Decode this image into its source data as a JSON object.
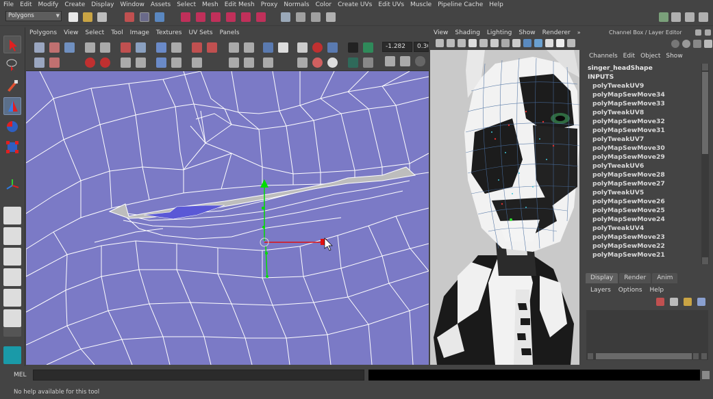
{
  "menubar": [
    "File",
    "Edit",
    "Modify",
    "Create",
    "Display",
    "Window",
    "Assets",
    "Select",
    "Mesh",
    "Edit Mesh",
    "Proxy",
    "Normals",
    "Color",
    "Create UVs",
    "Edit UVs",
    "Muscle",
    "Pipeline Cache",
    "Help"
  ],
  "mode_selector": "Polygons",
  "uv_editor": {
    "menu": [
      "Polygons",
      "View",
      "Select",
      "Tool",
      "Image",
      "Textures",
      "UV Sets",
      "Panels"
    ],
    "coord_u": "-1.282",
    "coord_v": "0.360"
  },
  "perspective": {
    "menu": [
      "View",
      "Shading",
      "Lighting",
      "Show",
      "Renderer"
    ]
  },
  "channel_box": {
    "title": "Channel Box / Layer Editor",
    "menu": [
      "Channels",
      "Edit",
      "Object",
      "Show"
    ],
    "object": "singer_headShape",
    "inputs_label": "INPUTS",
    "inputs": [
      "polyTweakUV9",
      "polyMapSewMove34",
      "polyMapSewMove33",
      "polyTweakUV8",
      "polyMapSewMove32",
      "polyMapSewMove31",
      "polyTweakUV7",
      "polyMapSewMove30",
      "polyMapSewMove29",
      "polyTweakUV6",
      "polyMapSewMove28",
      "polyMapSewMove27",
      "polyTweakUV5",
      "polyMapSewMove26",
      "polyMapSewMove25",
      "polyMapSewMove24",
      "polyTweakUV4",
      "polyMapSewMove23",
      "polyMapSewMove22",
      "polyMapSewMove21"
    ]
  },
  "layer_editor": {
    "tabs": [
      "Display",
      "Render",
      "Anim"
    ],
    "active_tab": "Display",
    "menu": [
      "Layers",
      "Options",
      "Help"
    ]
  },
  "command_line": {
    "label": "MEL"
  },
  "help_line": "No help available for this tool",
  "colors": {
    "uv_background": "#7b7ac6",
    "selected_faces": "#5a58d6",
    "wire": "#ffffff",
    "manip_y": "#00dd00",
    "manip_x": "#e01010"
  }
}
